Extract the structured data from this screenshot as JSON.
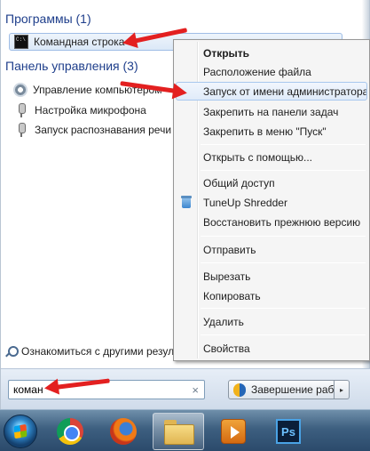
{
  "start_menu": {
    "sections": {
      "programs": "Программы (1)",
      "control_panel": "Панель управления (3)"
    },
    "program_results": [
      {
        "label": "Командная строка",
        "icon": "cmd-icon"
      }
    ],
    "control_panel_results": [
      {
        "label": "Управление компьютером",
        "icon": "gear-icon"
      },
      {
        "label": "Настройка микрофона",
        "icon": "microphone-icon"
      },
      {
        "label": "Запуск распознавания речи",
        "icon": "microphone-icon"
      }
    ],
    "more_results_link": "Ознакомиться с другими результатами",
    "search": {
      "value": "коман",
      "clear_glyph": "×"
    },
    "shutdown": {
      "label": "Завершение работы",
      "arrow_glyph": "▸"
    }
  },
  "context_menu": {
    "items": [
      {
        "label": "Открыть",
        "bold": true
      },
      {
        "label": "Расположение файла"
      },
      {
        "label": "Запуск от имени администратора",
        "highlighted": true
      },
      {
        "label": "Закрепить на панели задач"
      },
      {
        "label": "Закрепить в меню \"Пуск\""
      },
      {
        "label": "Открыть с помощью..."
      },
      {
        "label": "Общий доступ"
      },
      {
        "label": "TuneUp Shredder",
        "icon": "tuneup-shredder-icon"
      },
      {
        "label": "Восстановить прежнюю версию"
      },
      {
        "label": "Отправить"
      },
      {
        "label": "Вырезать"
      },
      {
        "label": "Копировать"
      },
      {
        "label": "Удалить"
      },
      {
        "label": "Свойства"
      }
    ]
  },
  "taskbar": {
    "buttons": [
      {
        "icon": "chrome-icon"
      },
      {
        "icon": "firefox-icon"
      },
      {
        "icon": "explorer-folder-icon"
      },
      {
        "icon": "media-player-icon"
      },
      {
        "icon": "photoshop-icon",
        "text": "Ps"
      }
    ]
  },
  "colors": {
    "section_title": "#1e3e8b",
    "annotation_arrow": "#e32020",
    "highlight_border": "#a8c8ee"
  }
}
